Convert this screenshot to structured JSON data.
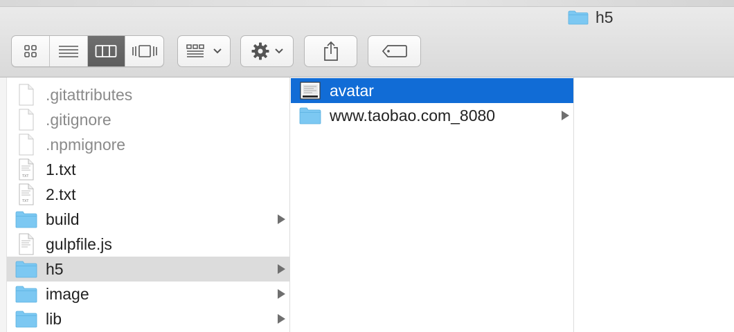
{
  "window": {
    "title": "h5"
  },
  "toolbar": {
    "view_modes": [
      "icon-view",
      "list-view",
      "column-view",
      "cover-flow-view"
    ],
    "active_view": "column-view",
    "buttons": [
      "arrange-menu",
      "action-menu",
      "share",
      "tags"
    ]
  },
  "column1": {
    "items": [
      {
        "name": ".gitattributes",
        "kind": "file",
        "hidden": true
      },
      {
        "name": ".gitignore",
        "kind": "file",
        "hidden": true
      },
      {
        "name": ".npmignore",
        "kind": "file",
        "hidden": true
      },
      {
        "name": "1.txt",
        "kind": "text"
      },
      {
        "name": "2.txt",
        "kind": "text"
      },
      {
        "name": "build",
        "kind": "folder"
      },
      {
        "name": "gulpfile.js",
        "kind": "text"
      },
      {
        "name": "h5",
        "kind": "folder",
        "selected": true
      },
      {
        "name": "image",
        "kind": "folder"
      },
      {
        "name": "lib",
        "kind": "folder"
      }
    ]
  },
  "column2": {
    "items": [
      {
        "name": "avatar",
        "kind": "image",
        "selected": true
      },
      {
        "name": "www.taobao.com_8080",
        "kind": "folder"
      }
    ]
  },
  "colors": {
    "selection_blue": "#116cd6",
    "selection_gray": "#dcdcdc",
    "folder_blue": "#7cc8f2"
  }
}
